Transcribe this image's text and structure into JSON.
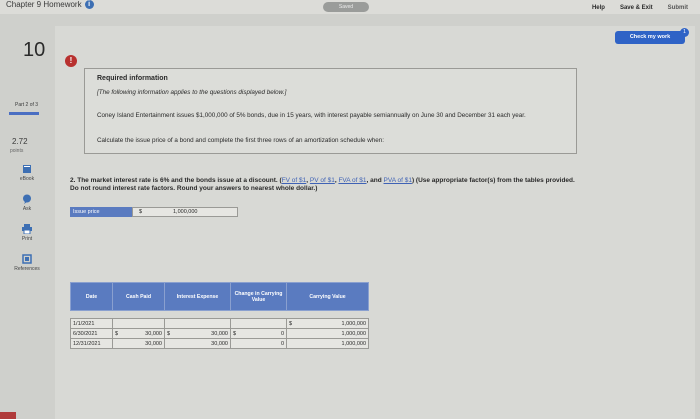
{
  "header": {
    "chapter_title": "Chapter 9 Homework",
    "saved_label": "Saved",
    "links": {
      "help": "Help",
      "save_exit": "Save & Exit",
      "submit": "Submit"
    }
  },
  "sidebar": {
    "question_number": "10",
    "part_label": "Part 2 of 3",
    "points_value": "2.72",
    "points_label": "points",
    "tools": [
      {
        "label": "eBook",
        "icon": "book-icon"
      },
      {
        "label": "Ask",
        "icon": "chat-icon"
      },
      {
        "label": "Print",
        "icon": "printer-icon"
      },
      {
        "label": "References",
        "icon": "references-icon"
      }
    ]
  },
  "check_work": {
    "label": "Check my work",
    "badge": "1"
  },
  "info_box": {
    "heading": "Required information",
    "note": "[The following information applies to the questions displayed below.]",
    "paragraph": "Coney Island Entertainment issues $1,000,000 of 5% bonds, due in 15 years, with interest payable semiannually on June 30 and December 31 each year.",
    "calc": "Calculate the issue price of a bond and complete the first three rows of an amortization schedule when:"
  },
  "question": {
    "prefix": "2. The market interest rate is 6% and the bonds issue at a discount. (",
    "links": [
      "FV of $1",
      "PV of $1",
      "FVA of $1",
      "PVA of $1"
    ],
    "suffix": ") (Use appropriate factor(s) from the tables provided. Do not round interest rate factors. Round your answers to nearest whole dollar.)"
  },
  "issue_price": {
    "label": "Issue price",
    "currency": "$",
    "value": "1,000,000"
  },
  "amortization": {
    "headers": [
      "Date",
      "Cash Paid",
      "Interest Expense",
      "Change in Carrying Value",
      "Carrying Value"
    ],
    "rows": [
      {
        "date": "1/1/2021",
        "cash": "",
        "cash_cur": "",
        "interest": "",
        "interest_cur": "",
        "change": "",
        "change_cur": "",
        "carrying": "1,000,000",
        "carrying_cur": "$"
      },
      {
        "date": "6/30/2021",
        "cash": "30,000",
        "cash_cur": "$",
        "interest": "30,000",
        "interest_cur": "$",
        "change": "0",
        "change_cur": "$",
        "carrying": "1,000,000",
        "carrying_cur": ""
      },
      {
        "date": "12/31/2021",
        "cash": "30,000",
        "cash_cur": "",
        "interest": "30,000",
        "interest_cur": "",
        "change": "0",
        "change_cur": "",
        "carrying": "1,000,000",
        "carrying_cur": ""
      }
    ]
  },
  "colors": {
    "accent": "#2f63c6",
    "table_header": "#5a7bc0",
    "alert": "#b8312f"
  }
}
